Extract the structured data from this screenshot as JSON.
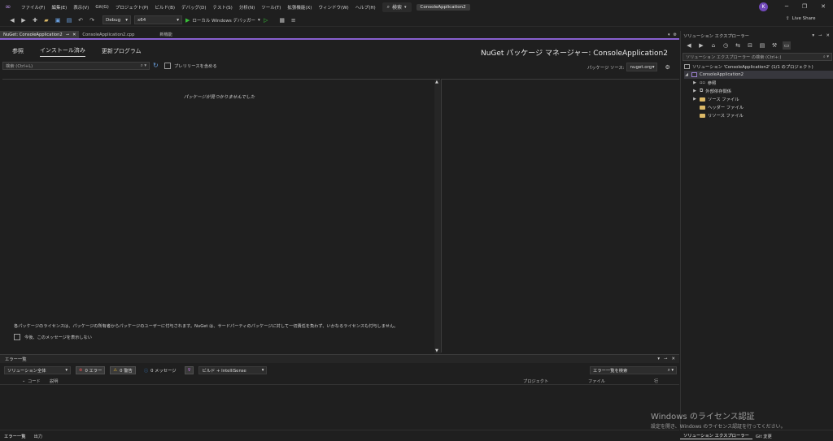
{
  "menu": {
    "items": [
      "ファイル(F)",
      "編集(E)",
      "表示(V)",
      "Git(G)",
      "プロジェクト(P)",
      "ビルド(B)",
      "デバッグ(D)",
      "テスト(S)",
      "分析(N)",
      "ツール(T)",
      "拡張機能(X)",
      "ウィンドウ(W)",
      "ヘルプ(H)"
    ],
    "search_label": "検索",
    "app_title": "ConsoleApplication2",
    "avatar_initial": "K"
  },
  "toolbar": {
    "config": "Debug",
    "platform": "x64",
    "debugger_label": "ローカル Windows デバッガー",
    "live_share": "Live Share"
  },
  "doc_tabs": [
    {
      "label": "NuGet: ConsoleApplication2",
      "active": true
    },
    {
      "label": "ConsoleApplication2.cpp",
      "active": false
    },
    {
      "label": "新機能",
      "active": false
    }
  ],
  "nuget": {
    "tabs": [
      "参照",
      "インストール済み",
      "更新プログラム"
    ],
    "selected_tab": "インストール済み",
    "title": "NuGet パッケージ マネージャー: ConsoleApplication2",
    "search_placeholder": "検索 (Ctrl+L)",
    "prerelease_label": "プレリリースを含める",
    "source_label": "パッケージ ソース:",
    "source_value": "nuget.org",
    "empty_message": "パッケージが見つかりませんでした",
    "license_note": "各パッケージのライセンスは、パッケージの所有者からパッケージのユーザーに付与されます。NuGet は、サードパーティのパッケージに対して一切責任を負わず、いかなるライセンスも付与しません。",
    "dont_show_label": "今後、このメッセージを表示しない"
  },
  "error_list": {
    "title": "エラー一覧",
    "scope": "ソリューション全体",
    "errors": "0 エラー",
    "warnings": "0 警告",
    "messages": "0 メッセージ",
    "build_filter": "ビルド + IntelliSense",
    "search_placeholder": "エラー一覧を検索",
    "columns": [
      "コード",
      "説明",
      "プロジェクト",
      "ファイル",
      "行"
    ]
  },
  "bottom_tabs": [
    "エラー一覧",
    "出力"
  ],
  "solution_explorer": {
    "title": "ソリューション エクスプローラー",
    "search_placeholder": "ソリューション エクスプローラー の検索 (Ctrl+:)",
    "solution_node": "ソリューション 'ConsoleApplication2' (1/1 のプロジェクト)",
    "project_node": "ConsoleApplication2",
    "children": [
      "参照",
      "外部依存関係",
      "ソース ファイル",
      "ヘッダー ファイル",
      "リソース ファイル"
    ],
    "bottom_tabs": [
      "ソリューション エクスプローラー",
      "Git 変更"
    ]
  },
  "watermark": {
    "title": "Windows のライセンス認証",
    "subtitle": "設定を開き、Windows のライセンス認証を行ってください。"
  },
  "colors": {
    "accent": "#8860d0",
    "background": "#1f1f1f",
    "run_green": "#38c038",
    "error_red": "#e05050",
    "warning_yellow": "#e0b030",
    "info_blue": "#3c8ce0"
  }
}
